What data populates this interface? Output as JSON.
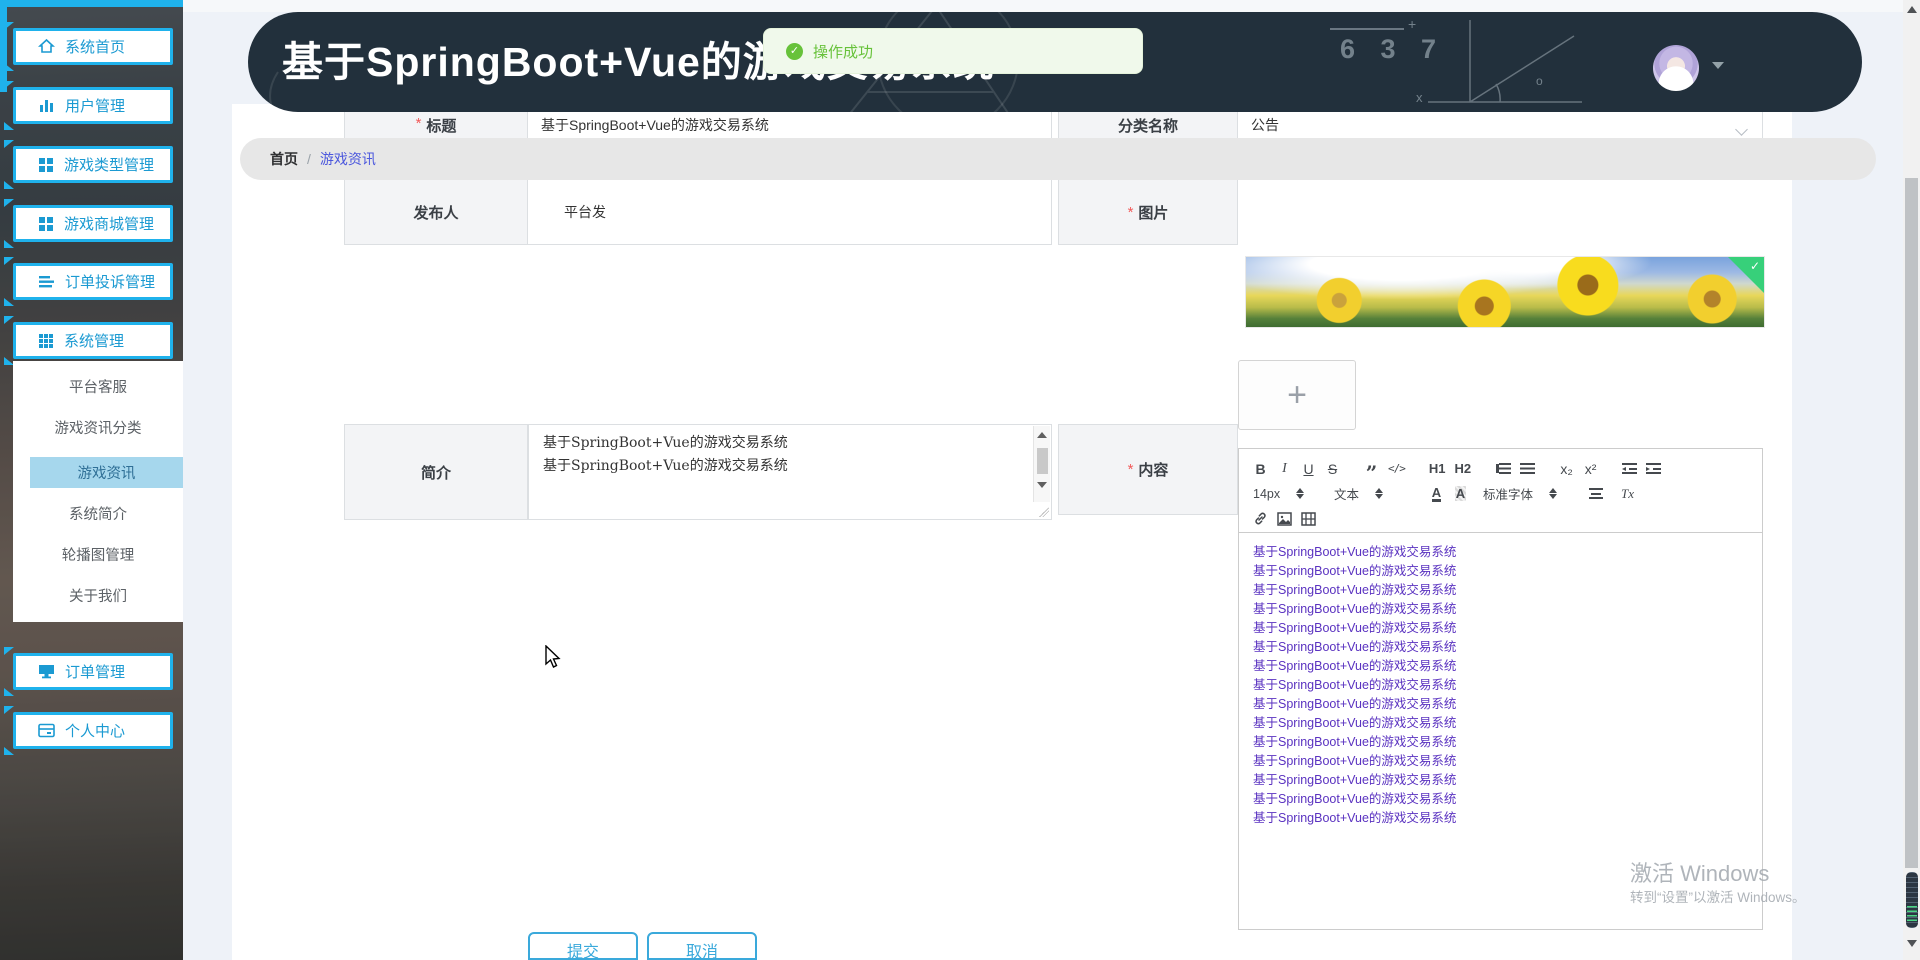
{
  "header": {
    "title": "基于SpringBoot+Vue的游戏交易系统",
    "chalk": {
      "numbers": "6 3 7",
      "plus": "+",
      "x_label": "x",
      "theta_label": "o"
    }
  },
  "toast": {
    "text": "操作成功",
    "check": "✓",
    "bg": "#f0f9eb",
    "color": "#67c23a"
  },
  "breadcrumb": {
    "home": "首页",
    "separator": "/",
    "current": "游戏资讯"
  },
  "sidebar": {
    "accent_color": "#1fb2ec",
    "menu": [
      {
        "label": "系统首页",
        "icon": "home-icon"
      },
      {
        "label": "用户管理",
        "icon": "bar-chart-icon"
      },
      {
        "label": "游戏类型管理",
        "icon": "grid-icon"
      },
      {
        "label": "游戏商城管理",
        "icon": "grid-icon"
      },
      {
        "label": "订单投诉管理",
        "icon": "list-icon"
      },
      {
        "label": "系统管理",
        "icon": "grid9-icon"
      },
      {
        "label": "订单管理",
        "icon": "monitor-icon"
      },
      {
        "label": "个人中心",
        "icon": "card-icon"
      }
    ],
    "submenu": {
      "items": [
        "平台客服",
        "游戏资讯分类",
        "游戏资讯",
        "系统简介",
        "轮播图管理",
        "关于我们"
      ],
      "active": "游戏资讯"
    }
  },
  "form": {
    "asterisk": "*",
    "title": {
      "label": "标题",
      "value": "基于SpringBoot+Vue的游戏交易系统"
    },
    "category": {
      "label": "分类名称",
      "value": "公告"
    },
    "publisher": {
      "label": "发布人",
      "value": "平台发"
    },
    "image": {
      "label": "图片",
      "upload_plus": "+",
      "badge_check": "✓"
    },
    "intro": {
      "label": "简介",
      "lines": [
        "基于SpringBoot+Vue的游戏交易系统",
        "基于SpringBoot+Vue的游戏交易系统"
      ]
    },
    "content": {
      "label": "内容"
    },
    "submit_label": "提交",
    "cancel_label": "取消"
  },
  "editor": {
    "toolbar": {
      "bold": "B",
      "italic": "I",
      "underline": "U",
      "strike": "S",
      "quote": "”",
      "code": "</>",
      "h1": "H1",
      "h2": "H2",
      "subscript": "x₂",
      "superscript": "x²",
      "size_value": "14px",
      "header_value": "文本",
      "font_value": "标准字体",
      "color": "A",
      "highlight": "A",
      "clean": "Tx"
    },
    "lines": [
      "基于SpringBoot+Vue的游戏交易系统",
      "基于SpringBoot+Vue的游戏交易系统",
      "基于SpringBoot+Vue的游戏交易系统",
      "基于SpringBoot+Vue的游戏交易系统",
      "基于SpringBoot+Vue的游戏交易系统",
      "基于SpringBoot+Vue的游戏交易系统",
      "基于SpringBoot+Vue的游戏交易系统",
      "基于SpringBoot+Vue的游戏交易系统",
      "基于SpringBoot+Vue的游戏交易系统",
      "基于SpringBoot+Vue的游戏交易系统",
      "基于SpringBoot+Vue的游戏交易系统",
      "基于SpringBoot+Vue的游戏交易系统",
      "基于SpringBoot+Vue的游戏交易系统",
      "基于SpringBoot+Vue的游戏交易系统",
      "基于SpringBoot+Vue的游戏交易系统"
    ],
    "text_color": "#5a32c0"
  },
  "watermark": {
    "line1": "激活 Windows",
    "line2": "转到“设置”以激活 Windows。"
  }
}
